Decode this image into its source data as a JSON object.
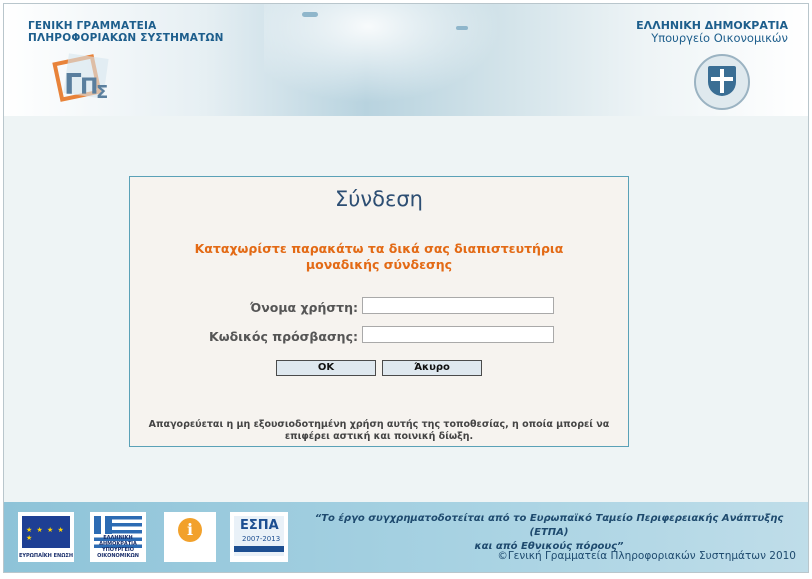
{
  "header": {
    "org_left_line1": "ΓΕΝΙΚΗ ΓΡΑΜΜΑΤΕΙΑ",
    "org_left_line2": "ΠΛΗΡΟΦΟΡΙΑΚΩΝ ΣΥΣΤΗΜΑΤΩΝ",
    "org_right_line1": "ΕΛΛΗΝΙΚΗ ΔΗΜΟΚΡΑΤΙΑ",
    "org_right_line2": "Υπουργείο Οικονομικών"
  },
  "login": {
    "title": "Σύνδεση",
    "instruction_line1": "Καταχωρίστε παρακάτω τα δικά σας διαπιστευτήρια",
    "instruction_line2": "μοναδικής σύνδεσης",
    "username_label": "Όνομα χρήστη:",
    "username_value": "",
    "password_label": "Κωδικός πρόσβασης:",
    "password_value": "",
    "ok_label": "OK",
    "cancel_label": "Άκυρο",
    "warning_line1": "Απαγορεύεται η μη εξουσιοδοτημένη χρήση αυτής της τοποθεσίας, η οποία μπορεί να",
    "warning_line2": "επιφέρει αστική και ποινική δίωξη."
  },
  "footer": {
    "eu_caption": "ΕΥΡΩΠΑΪΚΗ ΕΝΩΣΗ",
    "gr_caption": "ΕΛΛΗΝΙΚΗ ΔΗΜΟΚΡΑΤΙΑ ΥΠΟΥΡΓΕΙΟ ΟΙΚΟΝΟΜΙΚΩΝ",
    "espa_title": "ΕΣΠΑ",
    "espa_years": "2007-2013",
    "funding_line1": "“Το έργο συγχρηματοδοτείται από το Ευρωπαϊκό Ταμείο Περιφερειακής Ανάπτυξης (ΕΤΠΑ)",
    "funding_line2": "και από Εθνικούς πόρους”",
    "copyright": "©Γενική Γραμματεία Πληροφοριακών Συστημάτων 2010"
  },
  "colors": {
    "accent_orange": "#e36a15",
    "title_blue": "#2d4e73",
    "header_blue": "#1d5e8c"
  }
}
